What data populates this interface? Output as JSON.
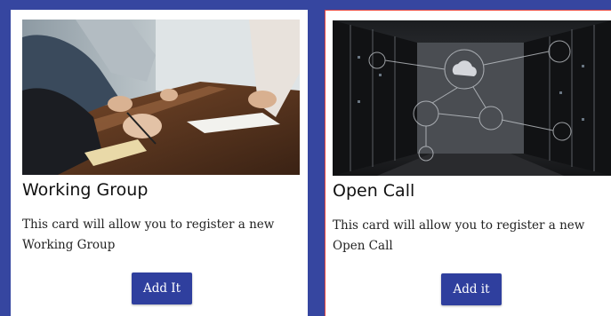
{
  "cards": [
    {
      "image_alt": "people-working-at-table-photo",
      "title": "Working Group",
      "text": "This card will allow you to register a new Working Group",
      "button_label": "Add It"
    },
    {
      "image_alt": "server-room-photo",
      "title": "Open Call",
      "text": "This card will allow you to register a new Open Call",
      "button_label": "Add it"
    }
  ],
  "colors": {
    "page_background": "#3646a0",
    "button": "#2f3f9e",
    "selected_border": "#e8473f"
  }
}
